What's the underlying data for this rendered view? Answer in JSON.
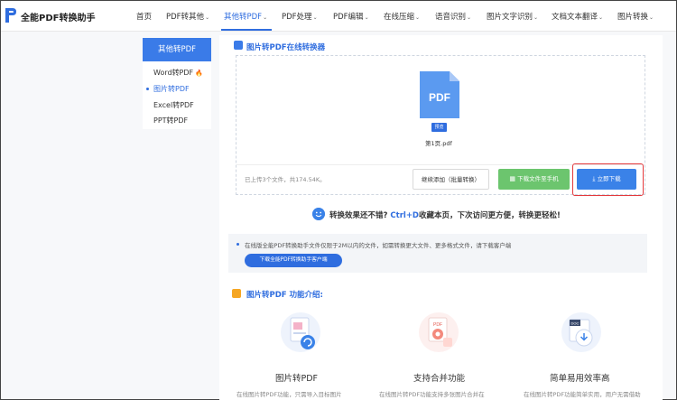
{
  "brand": {
    "name": "全能PDF转换助手"
  },
  "nav": {
    "items": [
      {
        "label": "首页",
        "caret": false,
        "active": false
      },
      {
        "label": "PDF转其他",
        "caret": true,
        "active": false
      },
      {
        "label": "其他转PDF",
        "caret": true,
        "active": true
      },
      {
        "label": "PDF处理",
        "caret": true,
        "active": false
      },
      {
        "label": "PDF编辑",
        "caret": true,
        "active": false
      },
      {
        "label": "在线压缩",
        "caret": true,
        "active": false
      },
      {
        "label": "语音识别",
        "caret": true,
        "active": false
      },
      {
        "label": "图片文字识别",
        "caret": true,
        "active": false
      },
      {
        "label": "文档文本翻译",
        "caret": true,
        "active": false
      },
      {
        "label": "图片转换",
        "caret": true,
        "active": false
      }
    ],
    "caret_glyph": "⌄"
  },
  "sidebar": {
    "header": "其他转PDF",
    "items": [
      {
        "label": "Word转PDF",
        "hot": true
      },
      {
        "label": "图片转PDF",
        "active": true
      },
      {
        "label": "Excel转PDF"
      },
      {
        "label": "PPT转PDF"
      }
    ]
  },
  "converter": {
    "title": "图片转PDF在线转换器",
    "file_icon_text": "PDF",
    "preview_label": "预览",
    "file_name": "第1页.pdf",
    "status": "已上传3个文件，共174.54K。",
    "btn_add": "继续添加（批量转换）",
    "btn_phone": "下载文件至手机",
    "btn_download": "立即下载"
  },
  "promo": {
    "prefix": "转换效果还不错?",
    "hotkey": "Ctrl+D",
    "suffix": "收藏本页，下次访问更方便，转换更轻松!"
  },
  "notice": {
    "text": "在线版全能PDF转换助手文件仅限于2M以内的文件，如需转换更大文件、更多格式文件，请下载客户端",
    "button": "下载全能PDF转换助手客户端"
  },
  "features": {
    "title": "图片转PDF 功能介绍:",
    "items": [
      {
        "title": "图片转PDF",
        "desc": "在线图片转PDF功能，只需导入目标图片"
      },
      {
        "title": "支持合并功能",
        "desc": "在线图片转PDF功能支持多张图片合并在"
      },
      {
        "title": "简单易用效率高",
        "desc": "在线图片转PDF功能简单实用，用户无需借助"
      }
    ]
  },
  "colors": {
    "primary": "#2f6ddf",
    "green": "#6cc56e",
    "highlight": "#e4393c"
  }
}
